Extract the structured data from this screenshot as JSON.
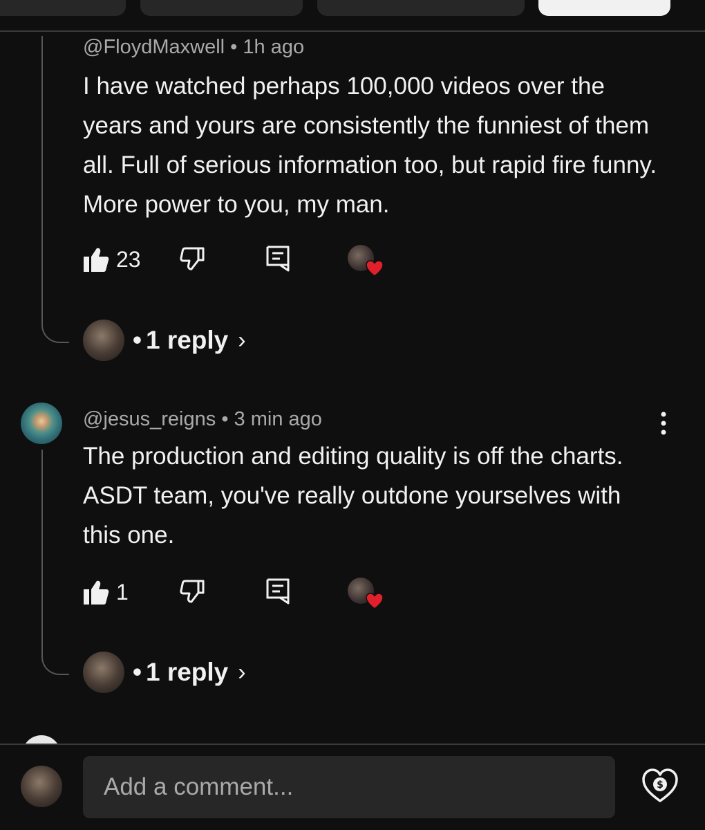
{
  "comments": [
    {
      "author": "@FloydMaxwell",
      "time": "1h ago",
      "text": "I have watched perhaps 100,000 videos over the years and yours are consistently the funniest of them all. Full of serious information too, but rapid fire funny. More power to you, my man.",
      "likes": "23",
      "replies": "1 reply"
    },
    {
      "author": "@jesus_reigns",
      "time": "3 min ago",
      "text": "The production and editing quality is off the charts. ASDT team, you've really outdone yourselves with this one.",
      "likes": "1",
      "replies": "1 reply"
    }
  ],
  "composer": {
    "placeholder": "Add a comment..."
  },
  "icons": {
    "like": "thumbs-up-icon",
    "dislike": "thumbs-down-icon",
    "reply": "reply-icon",
    "heart_badge": "creator-heart-icon",
    "more": "more-vert-icon",
    "thanks": "super-thanks-icon"
  },
  "colors": {
    "background": "#0f0f0f",
    "heart": "#e0202a",
    "text": "#f1f1f1",
    "secondary": "#aaaaaa"
  }
}
